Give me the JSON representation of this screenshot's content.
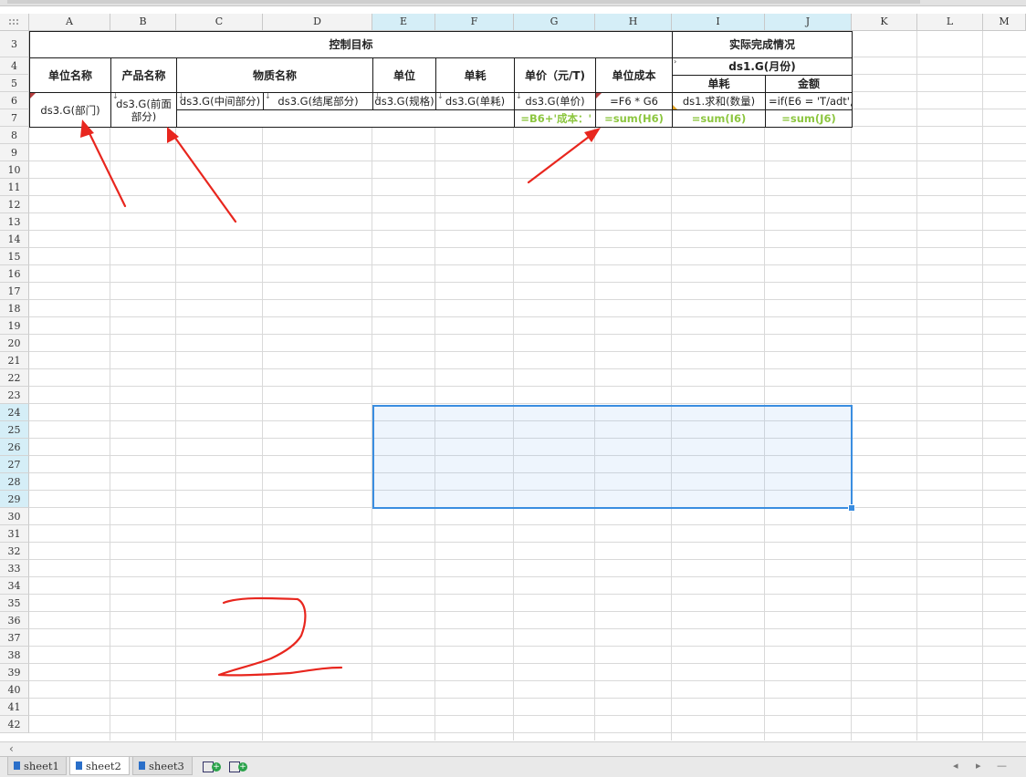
{
  "columns": [
    "A",
    "B",
    "C",
    "D",
    "E",
    "F",
    "G",
    "H",
    "I",
    "J",
    "K",
    "L",
    "M"
  ],
  "selected_columns": [
    "E",
    "F",
    "G",
    "H",
    "I",
    "J"
  ],
  "rows": [
    "3",
    "4",
    "5",
    "6",
    "7",
    "8",
    "9",
    "10",
    "11",
    "12",
    "13",
    "14",
    "15",
    "16",
    "17",
    "18",
    "19",
    "20",
    "21",
    "22",
    "23",
    "24",
    "25",
    "26",
    "27",
    "28",
    "29",
    "30",
    "31",
    "32",
    "33",
    "34",
    "35",
    "36",
    "37",
    "38",
    "39",
    "40",
    "41",
    "42"
  ],
  "selected_rows": [
    "24",
    "25",
    "26",
    "27",
    "28",
    "29"
  ],
  "cells": {
    "control_target": "控制目标",
    "actual_completion": "实际完成情况",
    "unit_name": "单位名称",
    "product_name": "产品名称",
    "material_name": "物质名称",
    "unit": "单位",
    "consumption": "单耗",
    "unit_price": "单价（元/T)",
    "unit_cost": "单位成本",
    "ds1_month": "ds1.G(月份)",
    "actual_consumption": "单耗",
    "amount": "金额",
    "a6": "ds3.G(部门)",
    "b6": "ds3.G(前面部分)",
    "c6": "ds3.G(中间部分)",
    "d6": "ds3.G(结尾部分)",
    "e6": "ds3.G(规格)",
    "f6": "ds3.G(单耗)",
    "g6": "ds3.G(单价)",
    "h6": "=F6 * G6",
    "i6": "ds1.求和(数量)",
    "j6": "=if(E6 = 'T/adt',",
    "g7": "=B6+'成本：'",
    "h7": "=sum(H6)",
    "i7": "=sum(I6)",
    "j7": "=sum(J6)"
  },
  "sheets": [
    {
      "label": "sheet1",
      "active": false
    },
    {
      "label": "sheet2",
      "active": true
    },
    {
      "label": "sheet3",
      "active": false
    }
  ],
  "colors": {
    "formula_green": "#8cc63f",
    "selection_blue": "#3a8de0",
    "header_selected": "#d5eef7",
    "annotation_red": "#e8261e"
  },
  "annotations": {
    "handwritten_number": "2"
  }
}
